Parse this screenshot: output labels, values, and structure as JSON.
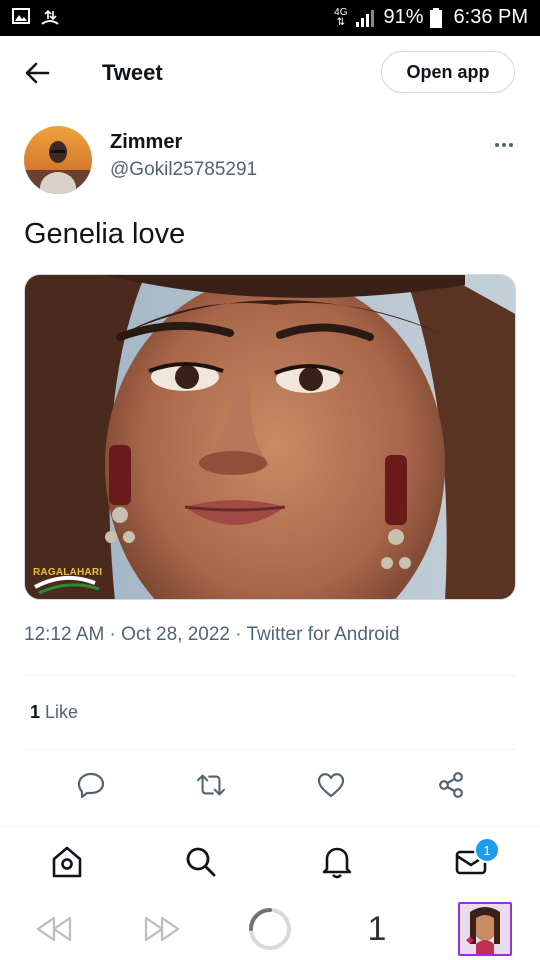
{
  "status_bar": {
    "network": "4G",
    "battery_percent": "91%",
    "time": "6:36 PM"
  },
  "header": {
    "title": "Tweet",
    "open_app_label": "Open app"
  },
  "tweet": {
    "author_name": "Zimmer",
    "author_handle": "@Gokil25785291",
    "text": "Genelia love",
    "image_watermark": "RAGALAHARI",
    "timestamp": "12:12 AM · Oct 28, 2022 · Twitter for Android",
    "like_count": "1",
    "like_label": " Like"
  },
  "bottom_nav": {
    "notification_badge": "1"
  },
  "browser_bar": {
    "tab_count": "1"
  }
}
